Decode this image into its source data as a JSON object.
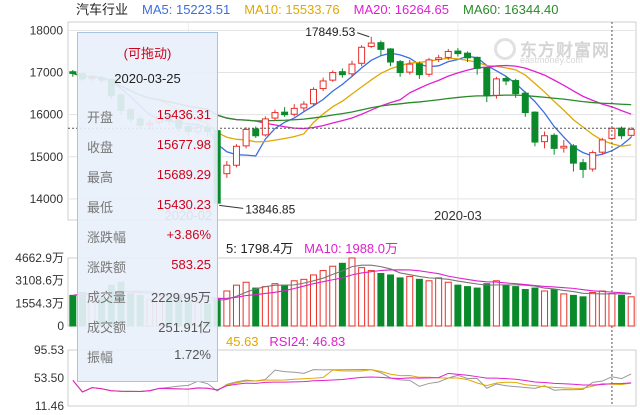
{
  "header": {
    "title": "汽车行业",
    "ma": [
      {
        "label": "MA5: 15223.51",
        "color": "#3b6ee0"
      },
      {
        "label": "MA10: 15533.76",
        "color": "#e0a800"
      },
      {
        "label": "MA20: 16264.65",
        "color": "#e020d0"
      },
      {
        "label": "MA60: 16344.40",
        "color": "#2a8a2a"
      }
    ]
  },
  "watermark": {
    "name": "东方财富网",
    "url": "eastmoney.com"
  },
  "price_axis": {
    "ticks": [
      "18000",
      "17000",
      "16000",
      "15000",
      "14000"
    ]
  },
  "date_axis": {
    "labels": [
      "2020-02",
      "2020-03"
    ]
  },
  "annotations": {
    "high": "17849.53",
    "low": "13846.85"
  },
  "tooltip": {
    "drag_hint": "(可拖动)",
    "date": "2020-03-25",
    "rows": [
      {
        "label": "开盘",
        "value": "15436.31",
        "color": "#d0021b"
      },
      {
        "label": "收盘",
        "value": "15677.98",
        "color": "#d0021b"
      },
      {
        "label": "最高",
        "value": "15689.29",
        "color": "#d0021b"
      },
      {
        "label": "最低",
        "value": "15430.23",
        "color": "#d0021b"
      },
      {
        "label": "涨跌幅",
        "value": "+3.86%",
        "color": "#d0021b"
      },
      {
        "label": "涨跌额",
        "value": "583.25",
        "color": "#d0021b"
      },
      {
        "label": "成交量",
        "value": "2229.95万",
        "color": "#555555"
      },
      {
        "label": "成交额",
        "value": "251.91亿",
        "color": "#555555"
      },
      {
        "label": "振幅",
        "value": "1.72%",
        "color": "#555555"
      }
    ]
  },
  "volume": {
    "legend_ma5": "5: 1798.4万",
    "legend_ma10": "MA10: 1988.0万",
    "ticks": [
      "4662.9万",
      "3108.6万",
      "1554.3万",
      "0"
    ]
  },
  "rsi": {
    "legend_a": "45.63",
    "legend_b": "RSI24: 46.83",
    "ticks": [
      "95.53",
      "53.50",
      "11.46"
    ]
  },
  "colors": {
    "up": "#e8302a",
    "down": "#0a8a2a",
    "grid": "#e3e3e3"
  },
  "chart_data": {
    "type": "candlestick",
    "unit": "index points",
    "ylim": [
      13500,
      18200
    ],
    "candles": [
      [
        17020,
        16980,
        17060,
        16900
      ],
      [
        16970,
        16850,
        17010,
        16800
      ],
      [
        16870,
        16880,
        16950,
        16760
      ],
      [
        16880,
        16820,
        16930,
        16750
      ],
      [
        16840,
        16450,
        16860,
        16380
      ],
      [
        16470,
        16100,
        16500,
        16000
      ],
      [
        16120,
        15900,
        16150,
        15820
      ],
      [
        15900,
        15750,
        15980,
        15650
      ],
      [
        15760,
        15800,
        15880,
        15640
      ],
      [
        15820,
        15950,
        16000,
        15760
      ],
      [
        15970,
        15850,
        16020,
        15760
      ],
      [
        15870,
        15700,
        15900,
        15600
      ],
      [
        15720,
        15600,
        15760,
        15500
      ],
      [
        15600,
        15700,
        15800,
        15520
      ],
      [
        15690,
        15600,
        15760,
        15480
      ],
      [
        15620,
        13900,
        15650,
        13846.85
      ],
      [
        14600,
        14800,
        14900,
        14500
      ],
      [
        14800,
        15250,
        15300,
        14750
      ],
      [
        15260,
        15650,
        15700,
        15200
      ],
      [
        15660,
        15500,
        15720,
        15450
      ],
      [
        15520,
        15900,
        15960,
        15480
      ],
      [
        15920,
        16050,
        16120,
        15850
      ],
      [
        16060,
        16000,
        16180,
        15950
      ],
      [
        16010,
        16150,
        16250,
        15960
      ],
      [
        16160,
        16250,
        16320,
        16080
      ],
      [
        16260,
        16600,
        16650,
        16200
      ],
      [
        16620,
        16800,
        16880,
        16560
      ],
      [
        16820,
        17000,
        17050,
        16780
      ],
      [
        17020,
        16950,
        17100,
        16880
      ],
      [
        16970,
        17200,
        17280,
        16900
      ],
      [
        17220,
        17600,
        17650,
        17150
      ],
      [
        17620,
        17700,
        17849.53,
        17580
      ],
      [
        17710,
        17550,
        17760,
        17400
      ],
      [
        17560,
        17250,
        17580,
        17150
      ],
      [
        17260,
        17000,
        17300,
        16900
      ],
      [
        17010,
        17200,
        17300,
        16950
      ],
      [
        17210,
        16950,
        17260,
        16850
      ],
      [
        16960,
        17300,
        17350,
        16900
      ],
      [
        17310,
        17350,
        17420,
        17250
      ],
      [
        17360,
        17500,
        17560,
        17300
      ],
      [
        17510,
        17450,
        17580,
        17380
      ],
      [
        17460,
        17350,
        17500,
        17250
      ],
      [
        17360,
        17100,
        17380,
        16950
      ],
      [
        17110,
        16450,
        17130,
        16300
      ],
      [
        16460,
        16850,
        16900,
        16380
      ],
      [
        16860,
        16800,
        16920,
        16700
      ],
      [
        16810,
        16500,
        16850,
        16400
      ],
      [
        16510,
        16050,
        16550,
        15950
      ],
      [
        16060,
        15350,
        16080,
        15250
      ],
      [
        15360,
        15500,
        15600,
        15200
      ],
      [
        15510,
        15200,
        15560,
        15050
      ],
      [
        15210,
        15250,
        15400,
        15100
      ],
      [
        15260,
        14850,
        15300,
        14650
      ],
      [
        14860,
        14700,
        14950,
        14500
      ],
      [
        14710,
        15100,
        15150,
        14650
      ],
      [
        15110,
        15400,
        15450,
        15050
      ],
      [
        15436.31,
        15677.98,
        15689.29,
        15430.23
      ],
      [
        15680,
        15500,
        15720,
        15420
      ],
      [
        15510,
        15650,
        15700,
        15460
      ]
    ],
    "volume": [
      2100,
      2300,
      2000,
      1900,
      2800,
      3000,
      2200,
      2100,
      1800,
      2000,
      1900,
      2100,
      1700,
      1600,
      1500,
      1900,
      2400,
      2800,
      3000,
      2600,
      2700,
      2900,
      2800,
      3100,
      3200,
      3500,
      3800,
      4100,
      4300,
      4662.9,
      4000,
      3800,
      3600,
      3500,
      3300,
      3400,
      3200,
      3100,
      3300,
      3000,
      2800,
      2700,
      2600,
      2900,
      3100,
      2800,
      2700,
      2500,
      2600,
      2400,
      2500,
      2200,
      2100,
      2000,
      2300,
      2400,
      2229.95,
      2100,
      2000
    ],
    "rsi_ylim": [
      11.46,
      95.53
    ]
  }
}
